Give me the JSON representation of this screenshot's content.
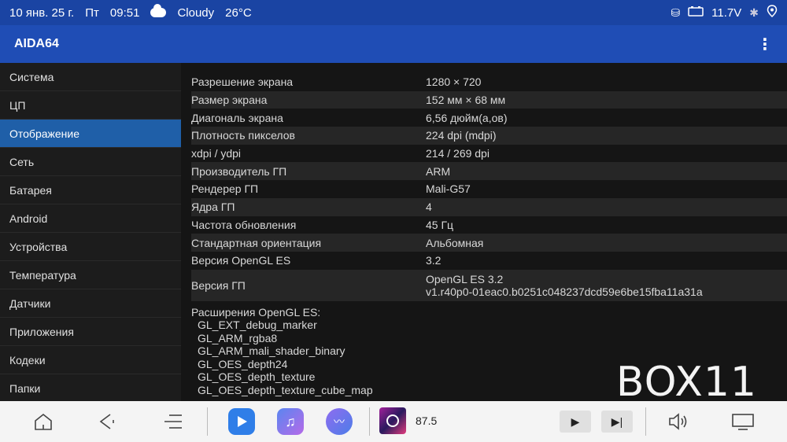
{
  "status": {
    "date": "10 янв. 25 г.",
    "day": "Пт",
    "time": "09:51",
    "weather": "Cloudy",
    "temp": "26°C",
    "voltage": "11.7V"
  },
  "app": {
    "title": "AIDA64"
  },
  "sidebar": {
    "items": [
      {
        "label": "Система"
      },
      {
        "label": "ЦП"
      },
      {
        "label": "Отображение"
      },
      {
        "label": "Сеть"
      },
      {
        "label": "Батарея"
      },
      {
        "label": "Android"
      },
      {
        "label": "Устройства"
      },
      {
        "label": "Температура"
      },
      {
        "label": "Датчики"
      },
      {
        "label": "Приложения"
      },
      {
        "label": "Кодеки"
      },
      {
        "label": "Папки"
      }
    ],
    "active_index": 2
  },
  "display": {
    "rows": [
      {
        "key": "Разрешение экрана",
        "value": "1280 × 720"
      },
      {
        "key": "Размер экрана",
        "value": "152 мм × 68 мм"
      },
      {
        "key": "Диагональ экрана",
        "value": "6,56 дюйм(а,ов)"
      },
      {
        "key": "Плотность пикселов",
        "value": "224 dpi (mdpi)"
      },
      {
        "key": "xdpi / ydpi",
        "value": "214 / 269 dpi"
      },
      {
        "key": "Производитель ГП",
        "value": "ARM"
      },
      {
        "key": "Рендерер ГП",
        "value": "Mali-G57"
      },
      {
        "key": "Ядра ГП",
        "value": "4"
      },
      {
        "key": "Частота обновления",
        "value": "45 Гц"
      },
      {
        "key": "Стандартная ориентация",
        "value": "Альбомная"
      },
      {
        "key": "Версия OpenGL ES",
        "value": "3.2"
      }
    ],
    "gpu_version": {
      "key": "Версия ГП",
      "line1": "OpenGL ES 3.2",
      "line2": "v1.r40p0-01eac0.b0251c048237dcd59e6be15fba11a31a"
    },
    "extensions_label": "Расширения OpenGL ES:",
    "extensions": [
      "GL_EXT_debug_marker",
      "GL_ARM_rgba8",
      "GL_ARM_mali_shader_binary",
      "GL_OES_depth24",
      "GL_OES_depth_texture",
      "GL_OES_depth_texture_cube_map"
    ]
  },
  "watermark": "BOX11",
  "bottombar": {
    "radio_freq": "87.5"
  }
}
